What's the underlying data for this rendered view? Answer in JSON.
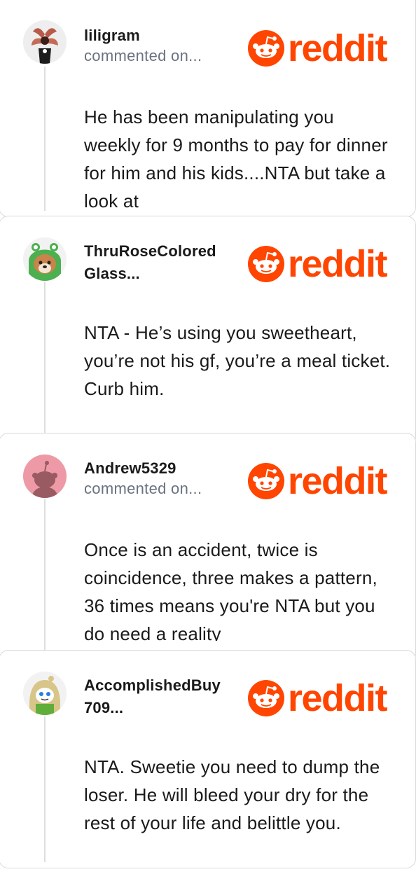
{
  "brand": {
    "wordmark": "reddit",
    "color": "#ff4500"
  },
  "comments": [
    {
      "username": "liligram",
      "meta": "commented on...",
      "avatar": "demogorgon-avatar",
      "body": "He has been manipulating you weekly for 9 months to pay for dinner for him and his kids....NTA but take a look at"
    },
    {
      "username": "ThruRoseColored Glass...",
      "meta": "",
      "avatar": "green-hood-dog-avatar",
      "body": "NTA - He’s using you sweetheart, you’re not his gf, you’re a meal ticket. Curb him."
    },
    {
      "username": "Andrew5329",
      "meta": "commented on...",
      "avatar": "default-snoo-avatar",
      "body": "Once is an accident, twice is coincidence, three makes a pattern, 36 times means you're NTA but you do need a reality"
    },
    {
      "username": "AccomplishedBuy 709...",
      "meta": "",
      "avatar": "blonde-snoo-avatar",
      "body": "NTA. Sweetie you need to dump the loser. He will bleed your dry for the rest of your life and belittle you."
    }
  ]
}
